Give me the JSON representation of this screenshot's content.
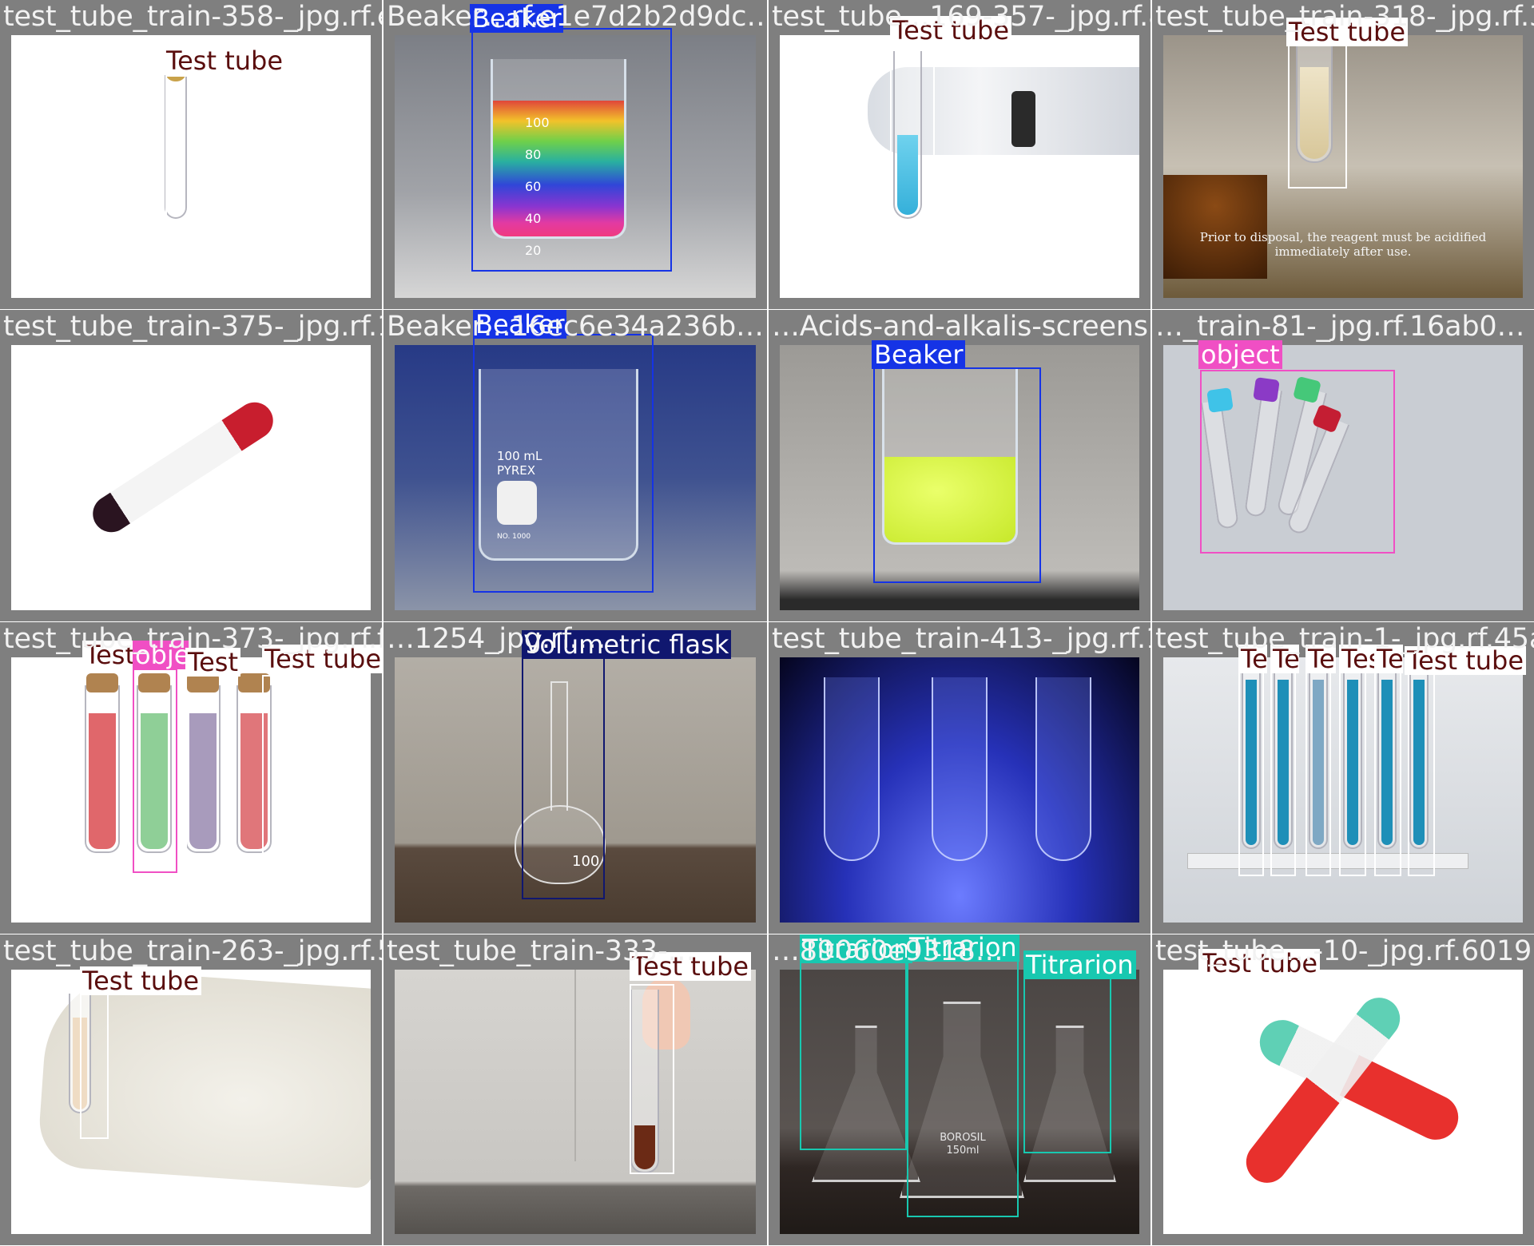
{
  "tiles": [
    {
      "filename": "test_tube_train-358-_jpg.rf.ebc6…",
      "labels": [
        "Test tube"
      ]
    },
    {
      "filename": "Beaker…rf.e1e7d2b2d9dc…",
      "labels": [
        "Beaker"
      ]
    },
    {
      "filename": "test_tube…169-357-_jpg.rf.84e9…",
      "labels": [
        "Test tube"
      ]
    },
    {
      "filename": "test_tube_train-318-_jpg.rf.31b8…",
      "labels": [
        "Test tube"
      ],
      "caption": [
        "Prior to disposal, the reagent must be acidified",
        "immediately after use."
      ]
    },
    {
      "filename": "test_tube_train-375-_jpg.rf.17d3…",
      "labels": [
        "Beaker"
      ]
    },
    {
      "filename": "Beaker…16ec6e34a236b…",
      "labels": [
        "Beaker"
      ]
    },
    {
      "filename": "…Acids-and-alkalis-screenshot…",
      "labels": [
        "Beaker"
      ]
    },
    {
      "filename": "…_train-81-_jpg.rf.16ab0…",
      "labels": [
        "object"
      ]
    },
    {
      "filename": "test_tube_train-373-_jpg.rf.f9f65…",
      "labels": [
        "Test",
        "objec",
        "Test",
        "Test tube"
      ]
    },
    {
      "filename": "…1254_jpg.rf.…",
      "labels": [
        "Volumetric flask"
      ]
    },
    {
      "filename": "test_tube_train-413-_jpg.rf.12a5…",
      "labels": []
    },
    {
      "filename": "test_tube_train-1-_jpg.rf.45aa4f",
      "labels": [
        "Te",
        "Te",
        "Te",
        "Tes",
        "Te",
        "Test tube"
      ]
    },
    {
      "filename": "test_tube_train-263-_jpg.rf.57c2…",
      "labels": [
        "Test tube"
      ]
    },
    {
      "filename": "test_tube_train-333-…",
      "labels": [
        "Test tube"
      ]
    },
    {
      "filename": "…89060e9318…",
      "labels": [
        "Titrarion",
        "Titrarion",
        "Titrarion"
      ]
    },
    {
      "filename": "test_tube…-10-_jpg.rf.6019…",
      "labels": [
        "Test tube"
      ]
    }
  ],
  "flask_marks": {
    "beaker_scale": [
      "100",
      "80",
      "60",
      "40",
      "20"
    ],
    "pyrex": [
      "100 mL",
      "PYREX",
      "NO. 1000"
    ],
    "flask_volume": "100",
    "titration_marks": [
      "BOROSIL",
      "150ml"
    ]
  },
  "colors": {
    "tile_bg": "#7f7f7f",
    "test_tube": "#ffffff",
    "test_tube_text": "#5a0e0e",
    "beaker": "#1533e6",
    "object": "#f04fc4",
    "volumetric_flask": "#10176f",
    "titrarion": "#18c8b0"
  }
}
